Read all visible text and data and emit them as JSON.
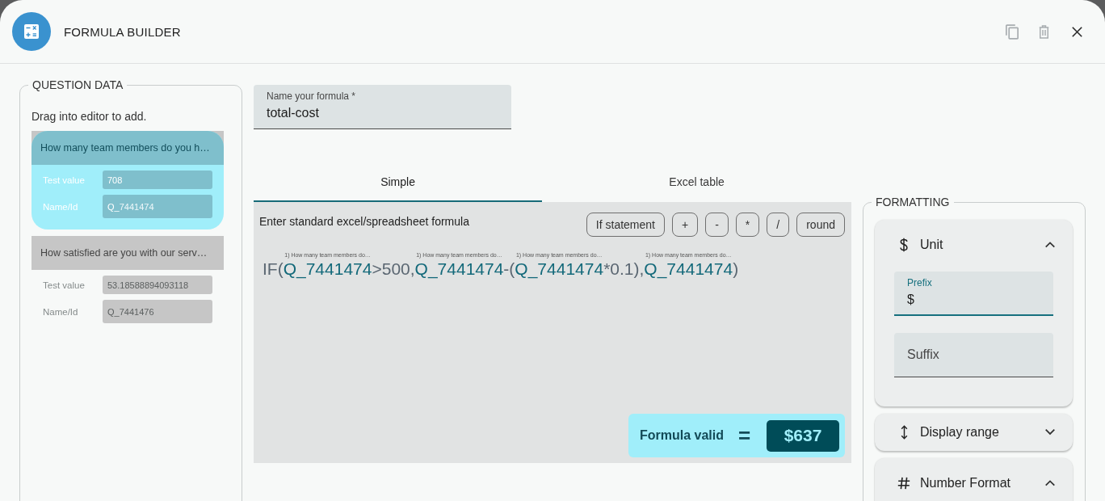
{
  "window": {
    "title": "FORMULA BUILDER",
    "actions": [
      {
        "kind": "copy",
        "disabled": true
      },
      {
        "kind": "delete",
        "disabled": true
      },
      {
        "kind": "close",
        "disabled": false
      }
    ]
  },
  "question_data": {
    "title": "QUESTION DATA",
    "hint": "Drag into editor to add.",
    "questions": [
      {
        "question": "How many team members do you h…",
        "selected": true,
        "test_value_label": "Test value",
        "test_value": "708",
        "name_label": "Name/Id",
        "name_id": {
          "prefix": "Q_",
          "value": "7441474"
        }
      },
      {
        "question": "How satisfied are you with our serv…",
        "selected": false,
        "test_value_label": "Test value",
        "test_value": "53.18588894093118",
        "name_label": "Name/Id",
        "name_id": {
          "prefix": "Q_",
          "value": "7441476"
        }
      }
    ]
  },
  "formula_name": {
    "label": "Name your formula *",
    "value": "total-cost"
  },
  "tabs": [
    {
      "label": "Simple",
      "selected": true
    },
    {
      "label": "Excel table",
      "selected": false
    }
  ],
  "editor": {
    "instruction": "Enter standard excel/spreadsheet formula",
    "buttons": [
      "If statement",
      "+",
      "-",
      "*",
      "/",
      "round"
    ],
    "formula": [
      {
        "kind": "text",
        "text": "IF("
      },
      {
        "kind": "ref",
        "label": "1) How many team members do…",
        "text": "Q_7441474"
      },
      {
        "kind": "text",
        "text": ">500,"
      },
      {
        "kind": "ref",
        "label": "1) How many team members do…",
        "text": "Q_7441474"
      },
      {
        "kind": "text",
        "text": "-("
      },
      {
        "kind": "ref",
        "label": "1) How many team members do…",
        "text": "Q_7441474"
      },
      {
        "kind": "text",
        "text": "*0.1),"
      },
      {
        "kind": "ref",
        "label": "1) How many team members do…",
        "text": "Q_7441474"
      },
      {
        "kind": "text",
        "text": ")"
      }
    ],
    "result": {
      "status": "Formula valid",
      "equals": "=",
      "value": "$637"
    }
  },
  "formatting": {
    "title": "FORMATTING",
    "sections": [
      {
        "kind": "unit",
        "title": "Unit",
        "expanded": true,
        "fields": [
          {
            "label": "Prefix",
            "value": "$",
            "focused": true
          },
          {
            "label": "Suffix",
            "focused": false
          }
        ]
      },
      {
        "kind": "range",
        "title": "Display range",
        "expanded": false
      },
      {
        "kind": "number",
        "title": "Number Format",
        "expanded": true
      }
    ]
  }
}
